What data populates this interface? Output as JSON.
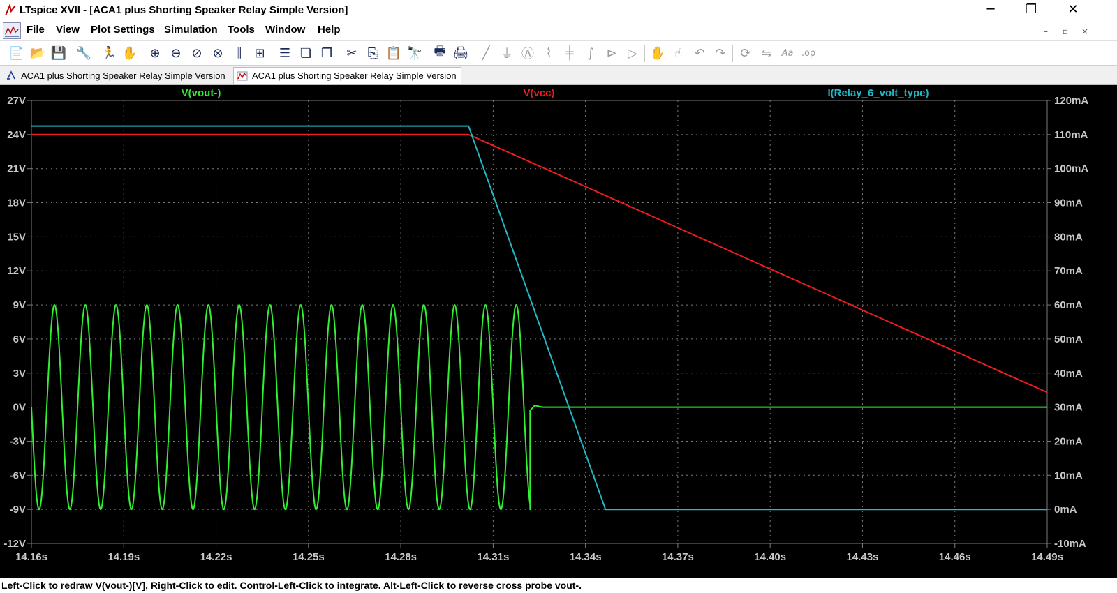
{
  "window": {
    "title": "LTspice XVII - [ACA1 plus Shorting Speaker Relay Simple Version]",
    "minimize_glyph": "─",
    "maximize_glyph": "❐",
    "close_glyph": "✕"
  },
  "menu": {
    "items": [
      "File",
      "View",
      "Plot Settings",
      "Simulation",
      "Tools",
      "Window",
      "Help"
    ],
    "mdi_minimize": "–",
    "mdi_restore": "▫",
    "mdi_close": "×"
  },
  "toolbar": {
    "buttons": [
      "new-schematic-icon",
      "open-icon",
      "save-icon",
      "control-panel-icon",
      "run-icon",
      "halt-icon",
      "zoom-in-icon",
      "zoom-out-icon",
      "zoom-back-icon",
      "zoom-fit-icon",
      "autorange-icon",
      "plot-settings-icon",
      "tile-horizontal-icon",
      "cascade-icon",
      "tile-vertical-icon",
      "cut-icon",
      "copy-icon",
      "paste-icon",
      "find-icon",
      "print-icon",
      "print-setup-icon",
      "wire-icon",
      "ground-icon",
      "label-icon",
      "resistor-icon",
      "capacitor-icon",
      "inductor-icon",
      "diode-icon",
      "component-icon",
      "move-icon",
      "drag-icon",
      "undo-icon",
      "redo-icon",
      "rotate-icon",
      "mirror-icon",
      "text-icon",
      "spice-directive-icon"
    ]
  },
  "tabs": [
    {
      "label": "ACA1 plus Shorting Speaker Relay Simple Version",
      "icon": "schematic-icon"
    },
    {
      "label": "ACA1 plus Shorting Speaker Relay Simple Version",
      "icon": "waveform-icon"
    }
  ],
  "colors": {
    "plot_bg": "#000000",
    "grid": "#7a7a7a",
    "axis_text": "#c8c8c8",
    "vout": "#33ee33",
    "vcc": "#ee1c1c",
    "relay": "#22b8c8"
  },
  "chart_data": {
    "type": "line",
    "x_label": "",
    "x_ticks": [
      "14.16s",
      "14.19s",
      "14.22s",
      "14.25s",
      "14.28s",
      "14.31s",
      "14.34s",
      "14.37s",
      "14.40s",
      "14.43s",
      "14.46s",
      "14.49s"
    ],
    "xlim": [
      14.16,
      14.49
    ],
    "y_left_ticks": [
      "27V",
      "24V",
      "21V",
      "18V",
      "15V",
      "12V",
      "9V",
      "6V",
      "3V",
      "0V",
      "-3V",
      "-6V",
      "-9V",
      "-12V"
    ],
    "ylim_left": [
      -12,
      27
    ],
    "y_right_ticks": [
      "120mA",
      "110mA",
      "100mA",
      "90mA",
      "80mA",
      "70mA",
      "60mA",
      "50mA",
      "40mA",
      "30mA",
      "20mA",
      "10mA",
      "0mA",
      "-10mA"
    ],
    "ylim_right": [
      -10,
      120
    ],
    "grid": true,
    "series": [
      {
        "name": "V(vout-)",
        "axis": "left",
        "kind": "sine_then_flat",
        "amplitude": 9,
        "period": 0.01,
        "start": 14.16,
        "stop": 14.322,
        "after_value": 0
      },
      {
        "name": "V(vcc)",
        "axis": "left",
        "x": [
          14.16,
          14.302,
          14.49
        ],
        "y": [
          24,
          24,
          1.3
        ]
      },
      {
        "name": "I(Relay_6_volt_type)",
        "axis": "right",
        "x": [
          14.16,
          14.302,
          14.3465,
          14.49
        ],
        "y": [
          112.5,
          112.5,
          0,
          0
        ]
      }
    ]
  },
  "status": {
    "text": "Left-Click to redraw V(vout-)[V],  Right-Click to edit. Control-Left-Click to integrate. Alt-Left-Click to reverse cross probe vout-."
  }
}
